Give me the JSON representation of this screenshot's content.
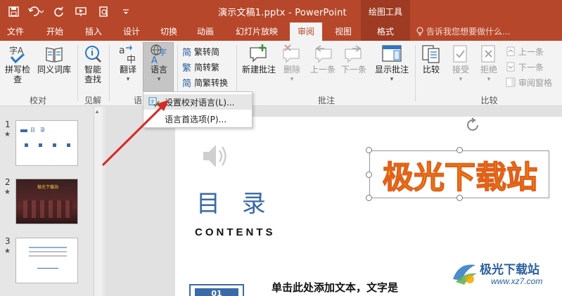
{
  "titlebar": {
    "doc_title": "演示文稿1.pptx - PowerPoint",
    "context_title": "绘图工具"
  },
  "tabs": [
    "文件",
    "开始",
    "插入",
    "设计",
    "切换",
    "动画",
    "幻灯片放映",
    "审阅",
    "视图",
    "格式"
  ],
  "active_tab": "审阅",
  "tell_me": "告诉我您想要做什么...",
  "ribbon": {
    "proofing": {
      "spell_check": "拼写检查",
      "thesaurus": "同义词库",
      "group": "校对"
    },
    "insights": {
      "smart_lookup_line1": "智能",
      "smart_lookup_line2": "查找",
      "group": "见解"
    },
    "language": {
      "translate": "翻译",
      "language": "语言",
      "group": "语"
    },
    "chinese": {
      "trad_to_simp": "繁转简",
      "simp_to_trad": "简转繁",
      "convert": "简繁转换"
    },
    "comments": {
      "new_comment": "新建批注",
      "delete": "删除",
      "previous": "上一条",
      "next": "下一条",
      "show_comments": "显示批注",
      "group": "批注"
    },
    "compare": {
      "compare": "比较",
      "accept": "接受",
      "reject": "拒绝",
      "prev_change": "上一条",
      "next_change": "下一条",
      "reviewing_pane": "审阅窗格",
      "group": "比较"
    }
  },
  "language_menu": {
    "items": [
      "设置校对语言(L)...",
      "语言首选项(P)..."
    ]
  },
  "slides": [
    {
      "number": "1",
      "star": "★",
      "thumb_title": "目　录"
    },
    {
      "number": "2",
      "star": "★",
      "thumb_title": "极光下载站"
    },
    {
      "number": "3",
      "star": "★"
    }
  ],
  "current_slide": {
    "title": "目 录",
    "subtitle": "CONTENTS",
    "wordart": "极光下载站",
    "number_box": "01",
    "body_text": "单击此处添加文本，文字是"
  },
  "watermark": {
    "name": "极光下载站",
    "url": "www.xz7.com"
  },
  "colors": {
    "accent": "#b7472a",
    "context": "#9e3b22",
    "title_blue": "#3a6aa8",
    "wordart_fill": "#f5c400",
    "wordart_stroke": "#e0601a"
  }
}
